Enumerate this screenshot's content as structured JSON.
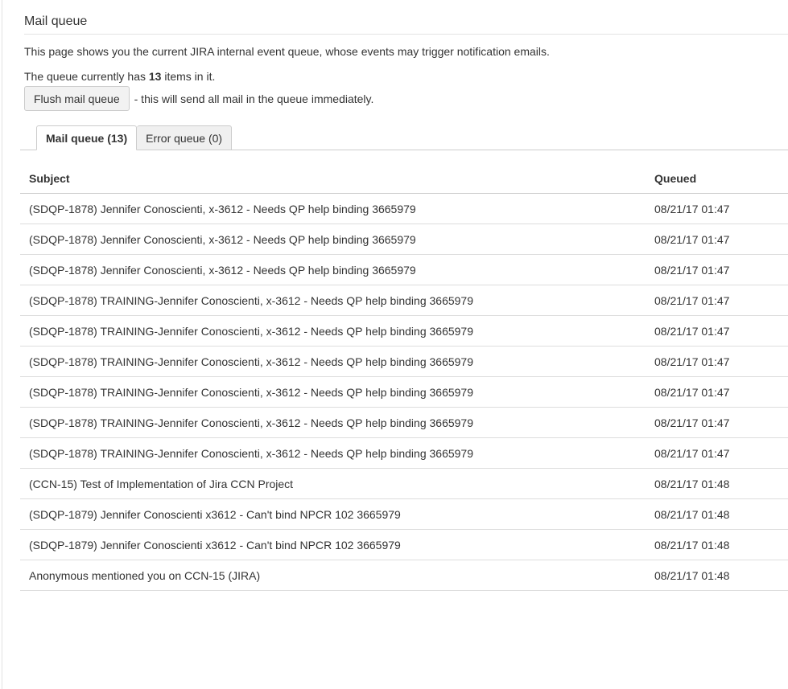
{
  "page": {
    "title": "Mail queue",
    "description": "This page shows you the current JIRA internal event queue, whose events may trigger notification emails.",
    "count_prefix": "The queue currently has ",
    "count_value": "13",
    "count_suffix": " items in it.",
    "flush_button_label": "Flush mail queue",
    "flush_note": "- this will send all mail in the queue immediately."
  },
  "tabs": [
    {
      "label": "Mail queue (13)",
      "active": true
    },
    {
      "label": "Error queue (0)",
      "active": false
    }
  ],
  "table": {
    "headers": {
      "subject": "Subject",
      "queued": "Queued"
    },
    "rows": [
      {
        "subject": "(SDQP-1878) Jennifer Conoscienti, x-3612 - Needs QP help binding 3665979",
        "queued": "08/21/17 01:47"
      },
      {
        "subject": "(SDQP-1878) Jennifer Conoscienti, x-3612 - Needs QP help binding 3665979",
        "queued": "08/21/17 01:47"
      },
      {
        "subject": "(SDQP-1878) Jennifer Conoscienti, x-3612 - Needs QP help binding 3665979",
        "queued": "08/21/17 01:47"
      },
      {
        "subject": "(SDQP-1878) TRAINING-Jennifer Conoscienti, x-3612 - Needs QP help binding 3665979",
        "queued": "08/21/17 01:47"
      },
      {
        "subject": "(SDQP-1878) TRAINING-Jennifer Conoscienti, x-3612 - Needs QP help binding 3665979",
        "queued": "08/21/17 01:47"
      },
      {
        "subject": "(SDQP-1878) TRAINING-Jennifer Conoscienti, x-3612 - Needs QP help binding 3665979",
        "queued": "08/21/17 01:47"
      },
      {
        "subject": "(SDQP-1878) TRAINING-Jennifer Conoscienti, x-3612 - Needs QP help binding 3665979",
        "queued": "08/21/17 01:47"
      },
      {
        "subject": "(SDQP-1878) TRAINING-Jennifer Conoscienti, x-3612 - Needs QP help binding 3665979",
        "queued": "08/21/17 01:47"
      },
      {
        "subject": "(SDQP-1878) TRAINING-Jennifer Conoscienti, x-3612 - Needs QP help binding 3665979",
        "queued": "08/21/17 01:47"
      },
      {
        "subject": "(CCN-15) Test of Implementation of Jira CCN Project",
        "queued": "08/21/17 01:48"
      },
      {
        "subject": "(SDQP-1879) Jennifer Conoscienti x3612 - Can't bind NPCR 102 3665979",
        "queued": "08/21/17 01:48"
      },
      {
        "subject": "(SDQP-1879) Jennifer Conoscienti x3612 - Can't bind NPCR 102 3665979",
        "queued": "08/21/17 01:48"
      },
      {
        "subject": "Anonymous mentioned you on CCN-15 (JIRA)",
        "queued": "08/21/17 01:48"
      }
    ]
  }
}
